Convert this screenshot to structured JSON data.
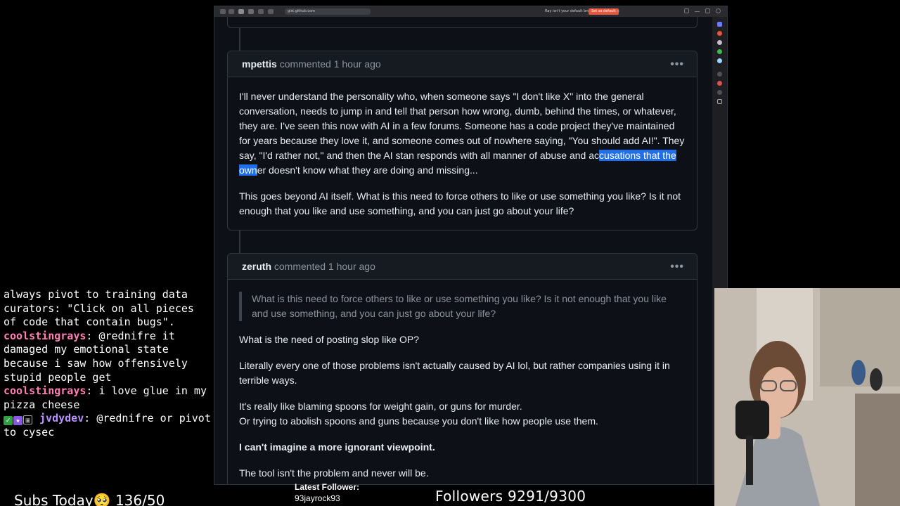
{
  "browser": {
    "url": "gist.github.com",
    "default_prompt": "Ray isn't your default browser",
    "set_default_label": "Set as default",
    "close_banner": "×"
  },
  "comments": [
    {
      "author": "mpettis",
      "meta": "commented 1 hour ago",
      "menu": "•••",
      "paragraphs": [
        {
          "before": "I'll never understand the personality who, when someone says \"I don't like X\" into the general conversation, needs to jump in and tell that person how wrong, dumb, behind the times, or whatever, they are. I've seen this now with AI in a few forums. Someone has a code project they've maintained for years because they love it, and someone comes out of nowhere saying, \"You should add AI!\". They say, \"I'd rather not,\" and then the AI stan responds with all manner of abuse and ac",
          "highlight": "cusations that the own",
          "after": "er doesn't know what they are doing and missing..."
        },
        {
          "text": "This goes beyond AI itself. What is this need to force others to like or use something you like? Is it not enough that you like and use something, and you can just go about your life?"
        }
      ]
    },
    {
      "author": "zeruth",
      "meta": "commented 1 hour ago",
      "menu": "•••",
      "quote": "What is this need to force others to like or use something you like? Is it not enough that you like and use something, and you can just go about your life?",
      "p1": "What is the need of posting slop like OP?",
      "p2": "Literally every one of those problems isn't actually caused by AI lol, but rather companies using it in terrible ways.",
      "p3a": "It's really like blaming spoons for weight gain, or guns for murder.",
      "p3b": "Or trying to abolish spoons and guns because you don't like how people use them.",
      "p4": "I can't imagine a more ignorant viewpoint.",
      "p5": "The tool isn't the problem and never will be."
    }
  ],
  "chat": [
    {
      "user": "",
      "text": "always pivot to training data curators: \"Click on all pieces of code that contain bugs\"."
    },
    {
      "user": "coolstingrays",
      "sep": ": ",
      "text": "@rednifre it damaged my emotional state because i saw how offensively stupid people get"
    },
    {
      "user": "coolstingrays",
      "sep": ": ",
      "text": "i love glue in my pizza cheese"
    },
    {
      "user": "jvdydev",
      "sep": ": ",
      "text": "@rednifre or pivot to cysec"
    }
  ],
  "chat_colors": {
    "coolstingrays": "#ff7fb4",
    "jvdydev": "#b892ff"
  },
  "stream": {
    "subs_today": "Subs Today🥺 136/50",
    "latest_follower_label": "Latest Follower:",
    "latest_follower_name": "93jayrock93",
    "followers": "Followers 9291/9300"
  }
}
